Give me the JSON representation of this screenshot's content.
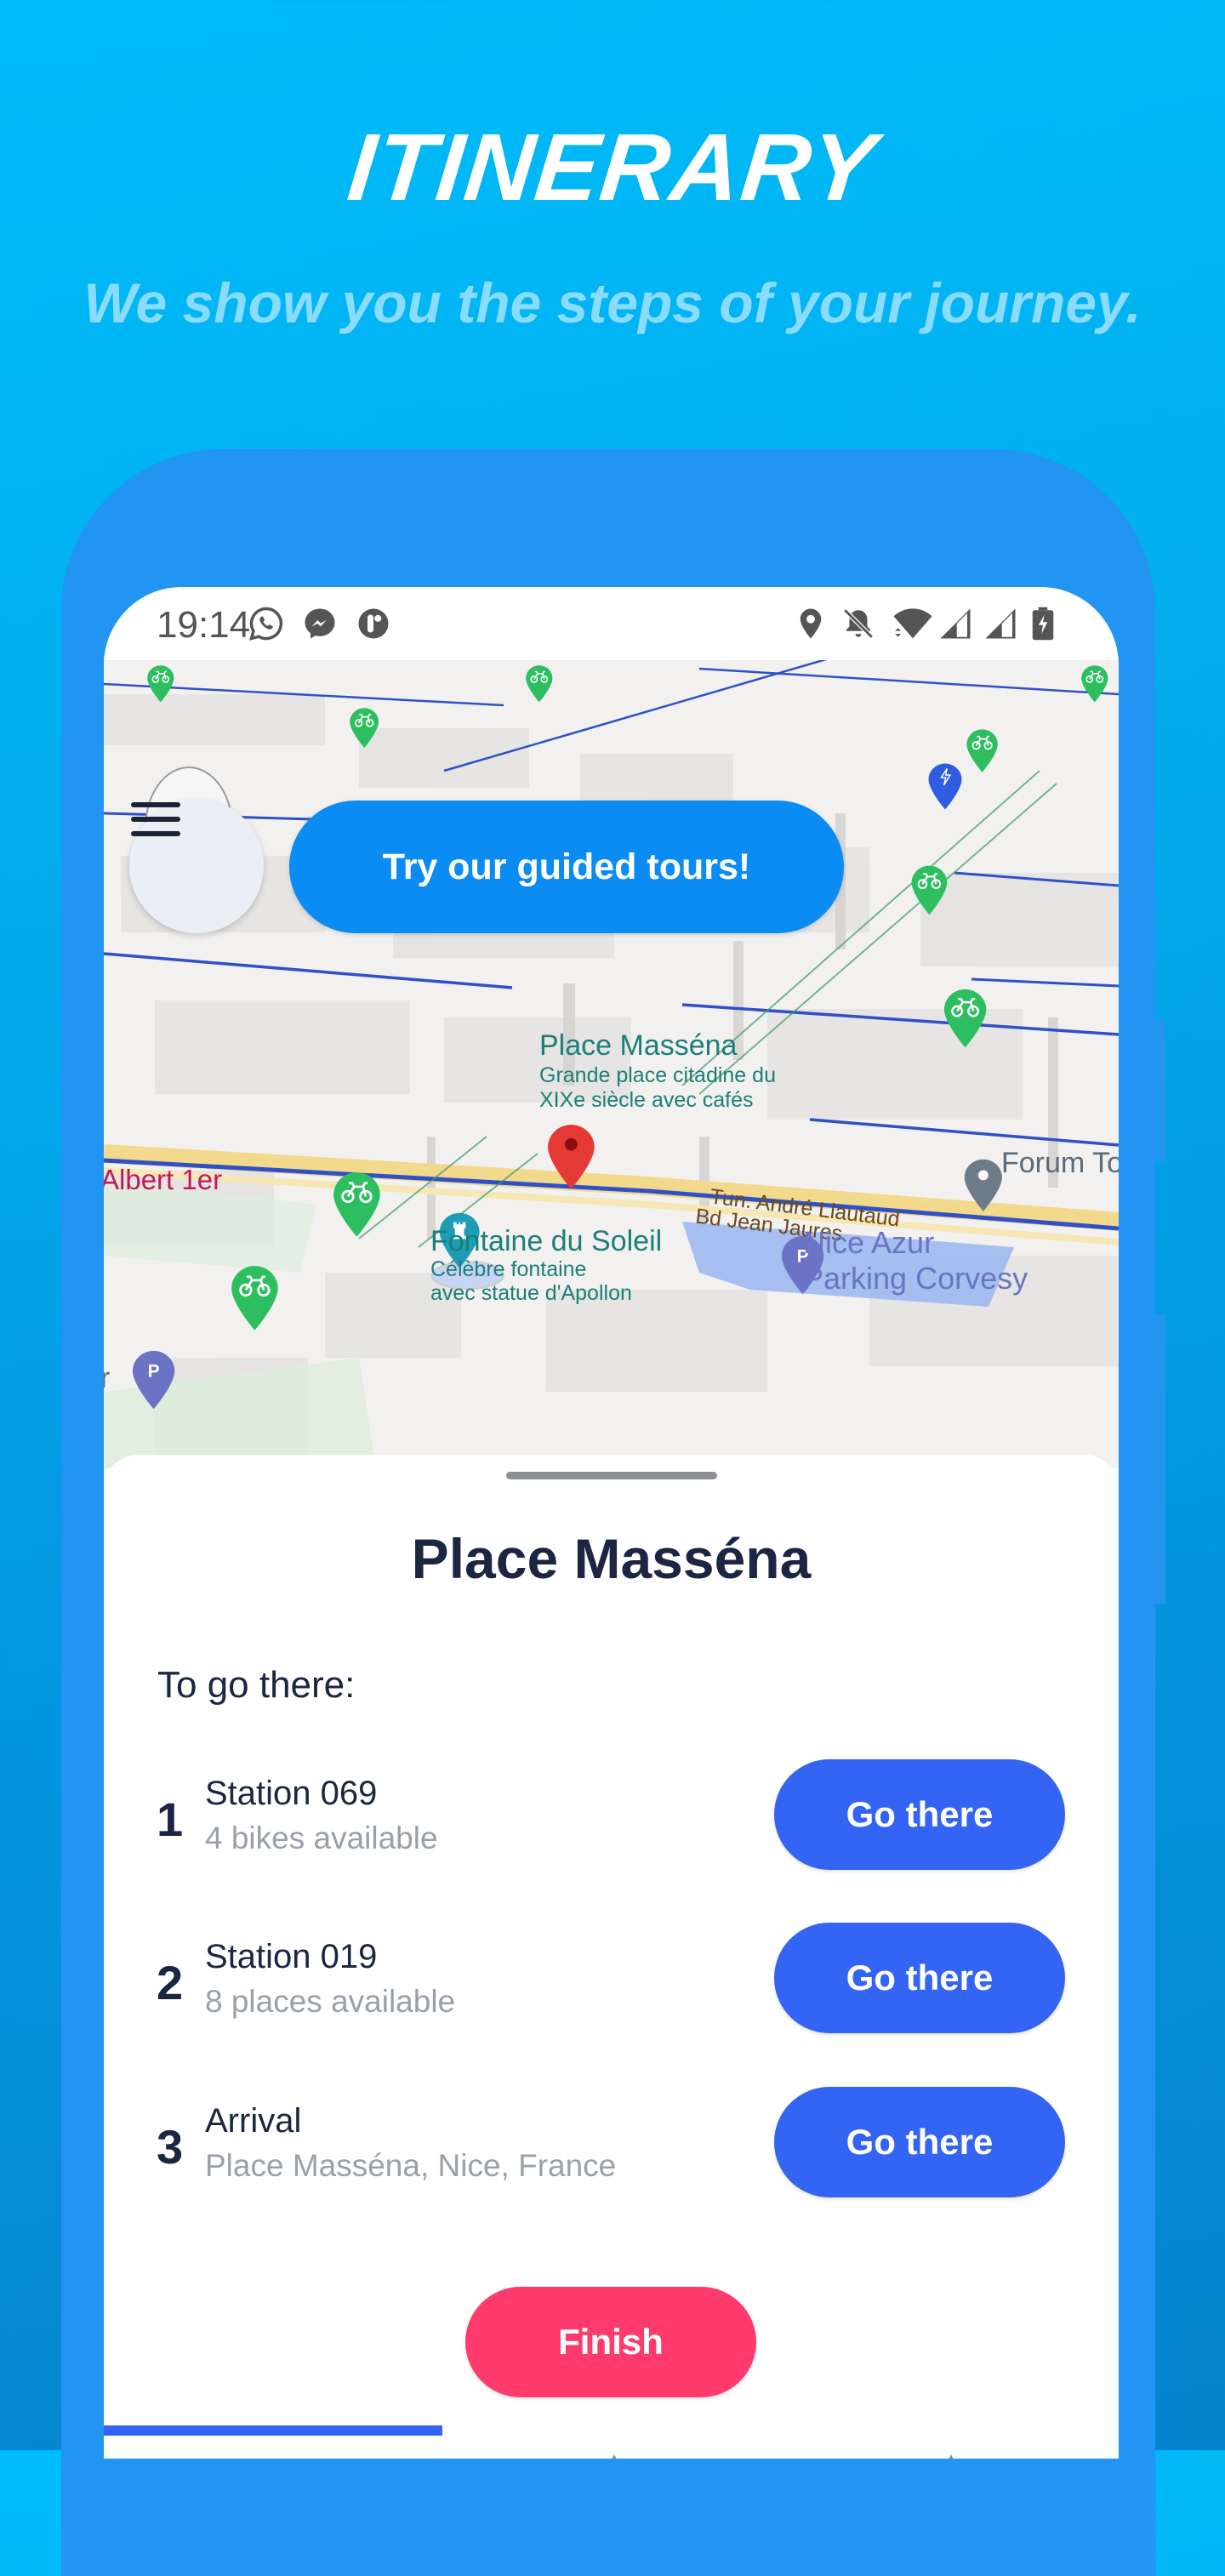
{
  "promo": {
    "title": "ITINERARY",
    "subtitle": "We show you the steps of your journey."
  },
  "status_bar": {
    "time": "19:14",
    "left_icons": [
      "whatsapp-icon",
      "messenger-icon",
      "app-notification-icon"
    ],
    "right_icons": [
      "location-icon",
      "bell-muted-icon",
      "wifi-icon",
      "signal-icon",
      "signal-icon",
      "battery-charging-icon"
    ]
  },
  "map": {
    "labels": {
      "place_massena_name": "Place Masséna",
      "place_massena_desc_1": "Grande place citadine du",
      "place_massena_desc_2": "XIXe siècle avec cafés",
      "road_albert": "Albert 1er",
      "fontaine_name": "Fontaine du Soleil",
      "fontaine_desc_1": "Célèbre fontaine",
      "fontaine_desc_2": "avec statue d'Apollon",
      "tunnel": "Tun. André Liautaud",
      "boulevard": "Bd Jean Jaures",
      "parking_1": "Nice Azur",
      "parking_2": "Parking Corvesy",
      "forum": "Forum To",
      "left_edge": "r"
    },
    "markers": [
      "bike-station",
      "bike-station",
      "bike-station",
      "bike-station",
      "bike-station",
      "bike-station",
      "bike-station",
      "bike-station",
      "bike-station",
      "charging-station",
      "destination-pin",
      "monument",
      "parking",
      "parking",
      "place"
    ],
    "colors": {
      "bike": "#2DBE60",
      "charging": "#2F5CE0",
      "destination": "#E53935",
      "route": "#2F50C8"
    }
  },
  "menu_button": {
    "icon": "hamburger-icon"
  },
  "tours_button": {
    "label": "Try our guided tours!"
  },
  "sheet": {
    "title": "Place Masséna",
    "subtitle": "To go there:",
    "steps": [
      {
        "number": "1",
        "title": "Station 069",
        "detail": "4 bikes available",
        "action": "Go there"
      },
      {
        "number": "2",
        "title": "Station 019",
        "detail": "8 places available",
        "action": "Go there"
      },
      {
        "number": "3",
        "title": "Arrival",
        "detail": "Place Masséna, Nice, France",
        "action": "Go there"
      }
    ],
    "finish_label": "Finish"
  },
  "colors": {
    "primary": "#3464F4",
    "accent_pink": "#FF3B6E",
    "tours_blue": "#0A8CF3",
    "phone_frame": "#2294F2",
    "text_dark": "#1C2541",
    "text_muted": "#9AA0AA"
  }
}
